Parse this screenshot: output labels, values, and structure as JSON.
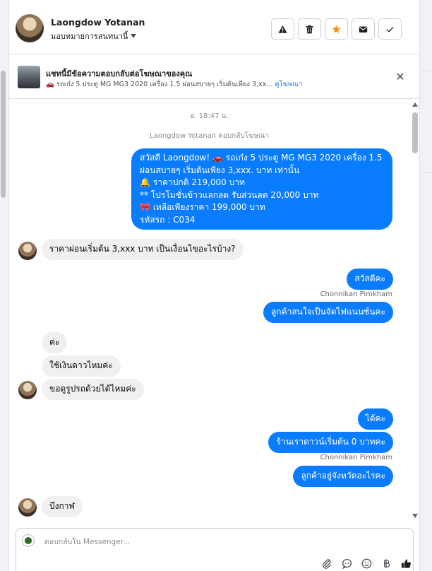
{
  "header": {
    "contact_name": "Laongdow Yotanan",
    "assign_label": "มอบหมายการสนทนานี้",
    "actions": [
      {
        "name": "report-button",
        "icon": "warning-icon"
      },
      {
        "name": "delete-button",
        "icon": "trash-icon"
      },
      {
        "name": "star-button",
        "icon": "star-icon",
        "color": "#f7931e"
      },
      {
        "name": "mark-unread-button",
        "icon": "envelope-icon"
      },
      {
        "name": "done-button",
        "icon": "checkmark-icon"
      }
    ]
  },
  "ad_banner": {
    "title": "แชทนี้มีข้อความตอบกลับต่อโฆษณาของคุณ",
    "subtitle": "🚗 รถเก๋ง 5 ประตู MG MG3 2020 เครื่อง 1.5 ผ่อนสบายๆ เริ่มต้นเพียง 3,xx...",
    "link_label": "ดูโฆษณา",
    "close_icon": "close-icon"
  },
  "conversation": {
    "timestamp": "อ. 18:47 น.",
    "ad_reply_note": "Laongdow Yotanan ตอบกลับโฆษณา",
    "ad_message": [
      "สวัสดี Laongdow! 🚗 รถเก๋ง 5 ประตู MG MG3 2020 เครื่อง 1.5",
      "ผ่อนสบายๆ เริ่มต้นเพียง 3,xxx. บาท เท่านั้น",
      "🔔 ราคาปกติ 219,000 บาท",
      "** โปรโมชั่นข้าวแลกลด รับส่วนลด 20,000 บาท",
      "🎀  เหลือเพียงราคา 199,000 บาท",
      "รหัสรถ : C034"
    ],
    "customer_question": "ราคาผ่อนเริ่มต้น 3,xxx บาท เป็นเงื่อนไขอะไรบ้าง?",
    "agent_greeting": "สวัสดีคะ",
    "agent_name_1": "Chonnikan Pimkham",
    "agent_reply_1": "ลูกค้าสนใจเป็นจัดไฟแนนซ์นคะ",
    "customer_1": "ค่ะ",
    "customer_2": "ใช้เงินดาวไหมค่ะ",
    "customer_3": "ขอดูรูปรถด้วยได้ไหมค่ะ",
    "agent_reply_2": "ได้คะ",
    "agent_reply_3": "ร้านเราดาวน์เริ่มต้น 0 บาทคะ",
    "agent_name_2": "Chonnikan Pimkham",
    "agent_reply_4": "ลูกค้าอยู่จังหวัดอะไรคะ",
    "customer_4": "บึงกาฬ"
  },
  "composer": {
    "placeholder": "ตอบกลับใน Messenger...",
    "tools": [
      "paperclip-icon",
      "chat-bubble-icon",
      "emoji-icon",
      "baht-icon",
      "thumbs-up-icon"
    ]
  },
  "colors": {
    "outgoing_bubble": "#0a7cff",
    "incoming_bubble": "#f0f0f0",
    "link": "#1877f2",
    "star": "#f7931e"
  }
}
